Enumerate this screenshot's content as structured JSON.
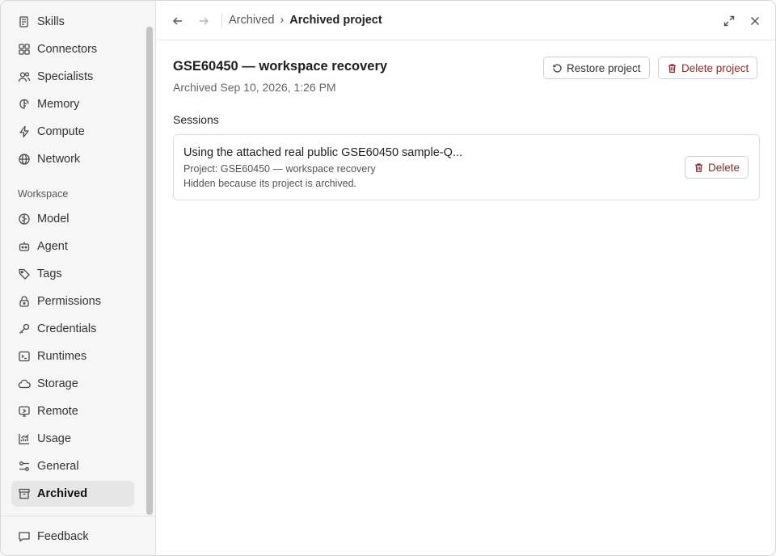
{
  "sidebar": {
    "items_top": [
      {
        "label": "Skills",
        "icon": "skills-icon"
      },
      {
        "label": "Connectors",
        "icon": "connectors-icon"
      },
      {
        "label": "Specialists",
        "icon": "specialists-icon"
      },
      {
        "label": "Memory",
        "icon": "memory-icon"
      },
      {
        "label": "Compute",
        "icon": "compute-icon"
      },
      {
        "label": "Network",
        "icon": "globe-icon"
      }
    ],
    "section_label": "Workspace",
    "items_workspace": [
      {
        "label": "Model",
        "icon": "brain-icon"
      },
      {
        "label": "Agent",
        "icon": "robot-icon"
      },
      {
        "label": "Tags",
        "icon": "tag-icon"
      },
      {
        "label": "Permissions",
        "icon": "lock-icon"
      },
      {
        "label": "Credentials",
        "icon": "key-icon"
      },
      {
        "label": "Runtimes",
        "icon": "terminal-icon"
      },
      {
        "label": "Storage",
        "icon": "cloud-icon"
      },
      {
        "label": "Remote",
        "icon": "remote-icon"
      },
      {
        "label": "Usage",
        "icon": "chart-icon"
      },
      {
        "label": "General",
        "icon": "sliders-icon"
      },
      {
        "label": "Archived",
        "icon": "archive-icon",
        "active": true
      }
    ],
    "feedback_label": "Feedback"
  },
  "topbar": {
    "breadcrumb_parent": "Archived",
    "breadcrumb_separator": "›",
    "breadcrumb_current": "Archived project"
  },
  "project": {
    "title": "GSE60450 — workspace recovery",
    "archived_at": "Archived Sep 10, 2026, 1:26 PM",
    "restore_label": "Restore project",
    "delete_label": "Delete project"
  },
  "sessions": {
    "heading": "Sessions",
    "items": [
      {
        "title": "Using the attached real public GSE60450 sample-Q...",
        "project": "Project: GSE60450 — workspace recovery",
        "note": "Hidden because its project is archived.",
        "delete_label": "Delete"
      }
    ]
  },
  "colors": {
    "danger": "#8a2a2a",
    "active_bg": "#e6e6e6"
  }
}
